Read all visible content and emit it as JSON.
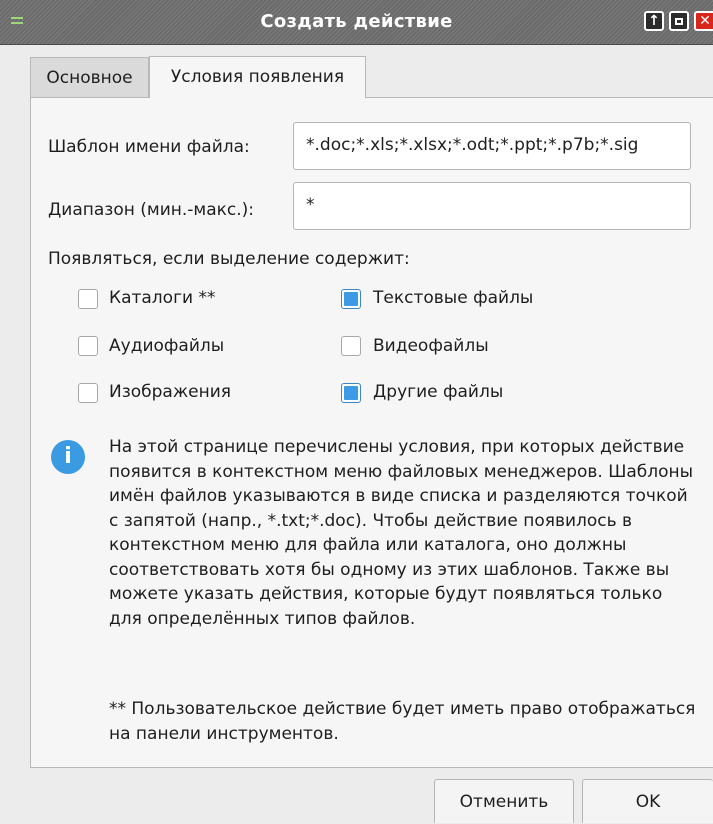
{
  "window": {
    "title": "Создать действие"
  },
  "titlebar_buttons": {
    "up_glyph": "↑",
    "close_glyph": "✕"
  },
  "tabs": [
    {
      "label": "Основное",
      "selected": false
    },
    {
      "label": "Условия появления",
      "selected": true
    }
  ],
  "form": {
    "filename_pattern": {
      "label": "Шаблон имени файла:",
      "value": "*.doc;*.xls;*.xlsx;*.odt;*.ppt;*.p7b;*.sig"
    },
    "range": {
      "label": "Диапазон (мин.-макс.):",
      "value": "*"
    },
    "appear_label": "Появляться, если выделение содержит:"
  },
  "checkboxes": [
    {
      "label": "Каталоги **",
      "checked": false
    },
    {
      "label": "Текстовые файлы",
      "checked": true
    },
    {
      "label": "Аудиофайлы",
      "checked": false
    },
    {
      "label": "Видеофайлы",
      "checked": false
    },
    {
      "label": "Изображения",
      "checked": false
    },
    {
      "label": "Другие файлы",
      "checked": true
    }
  ],
  "info": {
    "icon": "info-icon",
    "icon_glyph": "i",
    "text": "На этой странице перечислены условия, при которых действие появится в контекстном меню файловых менеджеров. Шаблоны имён файлов указываются в виде списка и разделяются точкой с запятой (напр., *.txt;*.doc). Чтобы действие появилось в контекстном меню для файла или каталога, оно должны соответствовать хотя бы одному из этих шаблонов. Также вы можете указать действия, которые будут появляться только для определённых типов файлов.",
    "note": "** Пользовательское действие будет иметь право отображаться на панели инструментов."
  },
  "buttons": {
    "cancel": "Отменить",
    "ok": "OK"
  },
  "colors": {
    "accent": "#3d9ae4",
    "close": "#d9261c",
    "titlebar": "#727272"
  }
}
